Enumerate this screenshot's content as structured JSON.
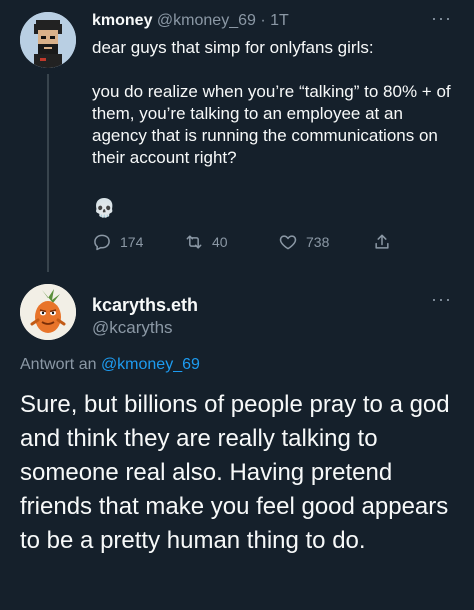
{
  "original_tweet": {
    "author_name": "kmoney",
    "author_handle": "@kmoney_69",
    "time": "· 1T",
    "more": "···",
    "text_line1": "dear guys that simp for onlyfans girls:",
    "text_para2": "you do realize when you’re “talking” to 80% + of them, you’re talking to an employee at an agency that is running the communications on their account right?",
    "emoji": "💀",
    "stats": {
      "replies": "174",
      "retweets": "40",
      "likes": "738"
    }
  },
  "reply_tweet": {
    "author_name": "kcaryths.eth",
    "author_handle": "@kcaryths",
    "more": "···",
    "reply_prefix": "Antwort an",
    "reply_to_handle": "@kmoney_69",
    "text": "Sure, but billions of people pray to a god and think they are really talking to someone real also.  Having pretend friends that make you feel good appears to be a pretty human thing to do."
  },
  "icons": {
    "reply": "reply-icon",
    "retweet": "retweet-icon",
    "like": "heart-icon",
    "share": "share-icon"
  },
  "colors": {
    "background": "#15202b",
    "text": "#f7f9f9",
    "secondary": "#8b98a5",
    "link": "#1d9bf0"
  }
}
